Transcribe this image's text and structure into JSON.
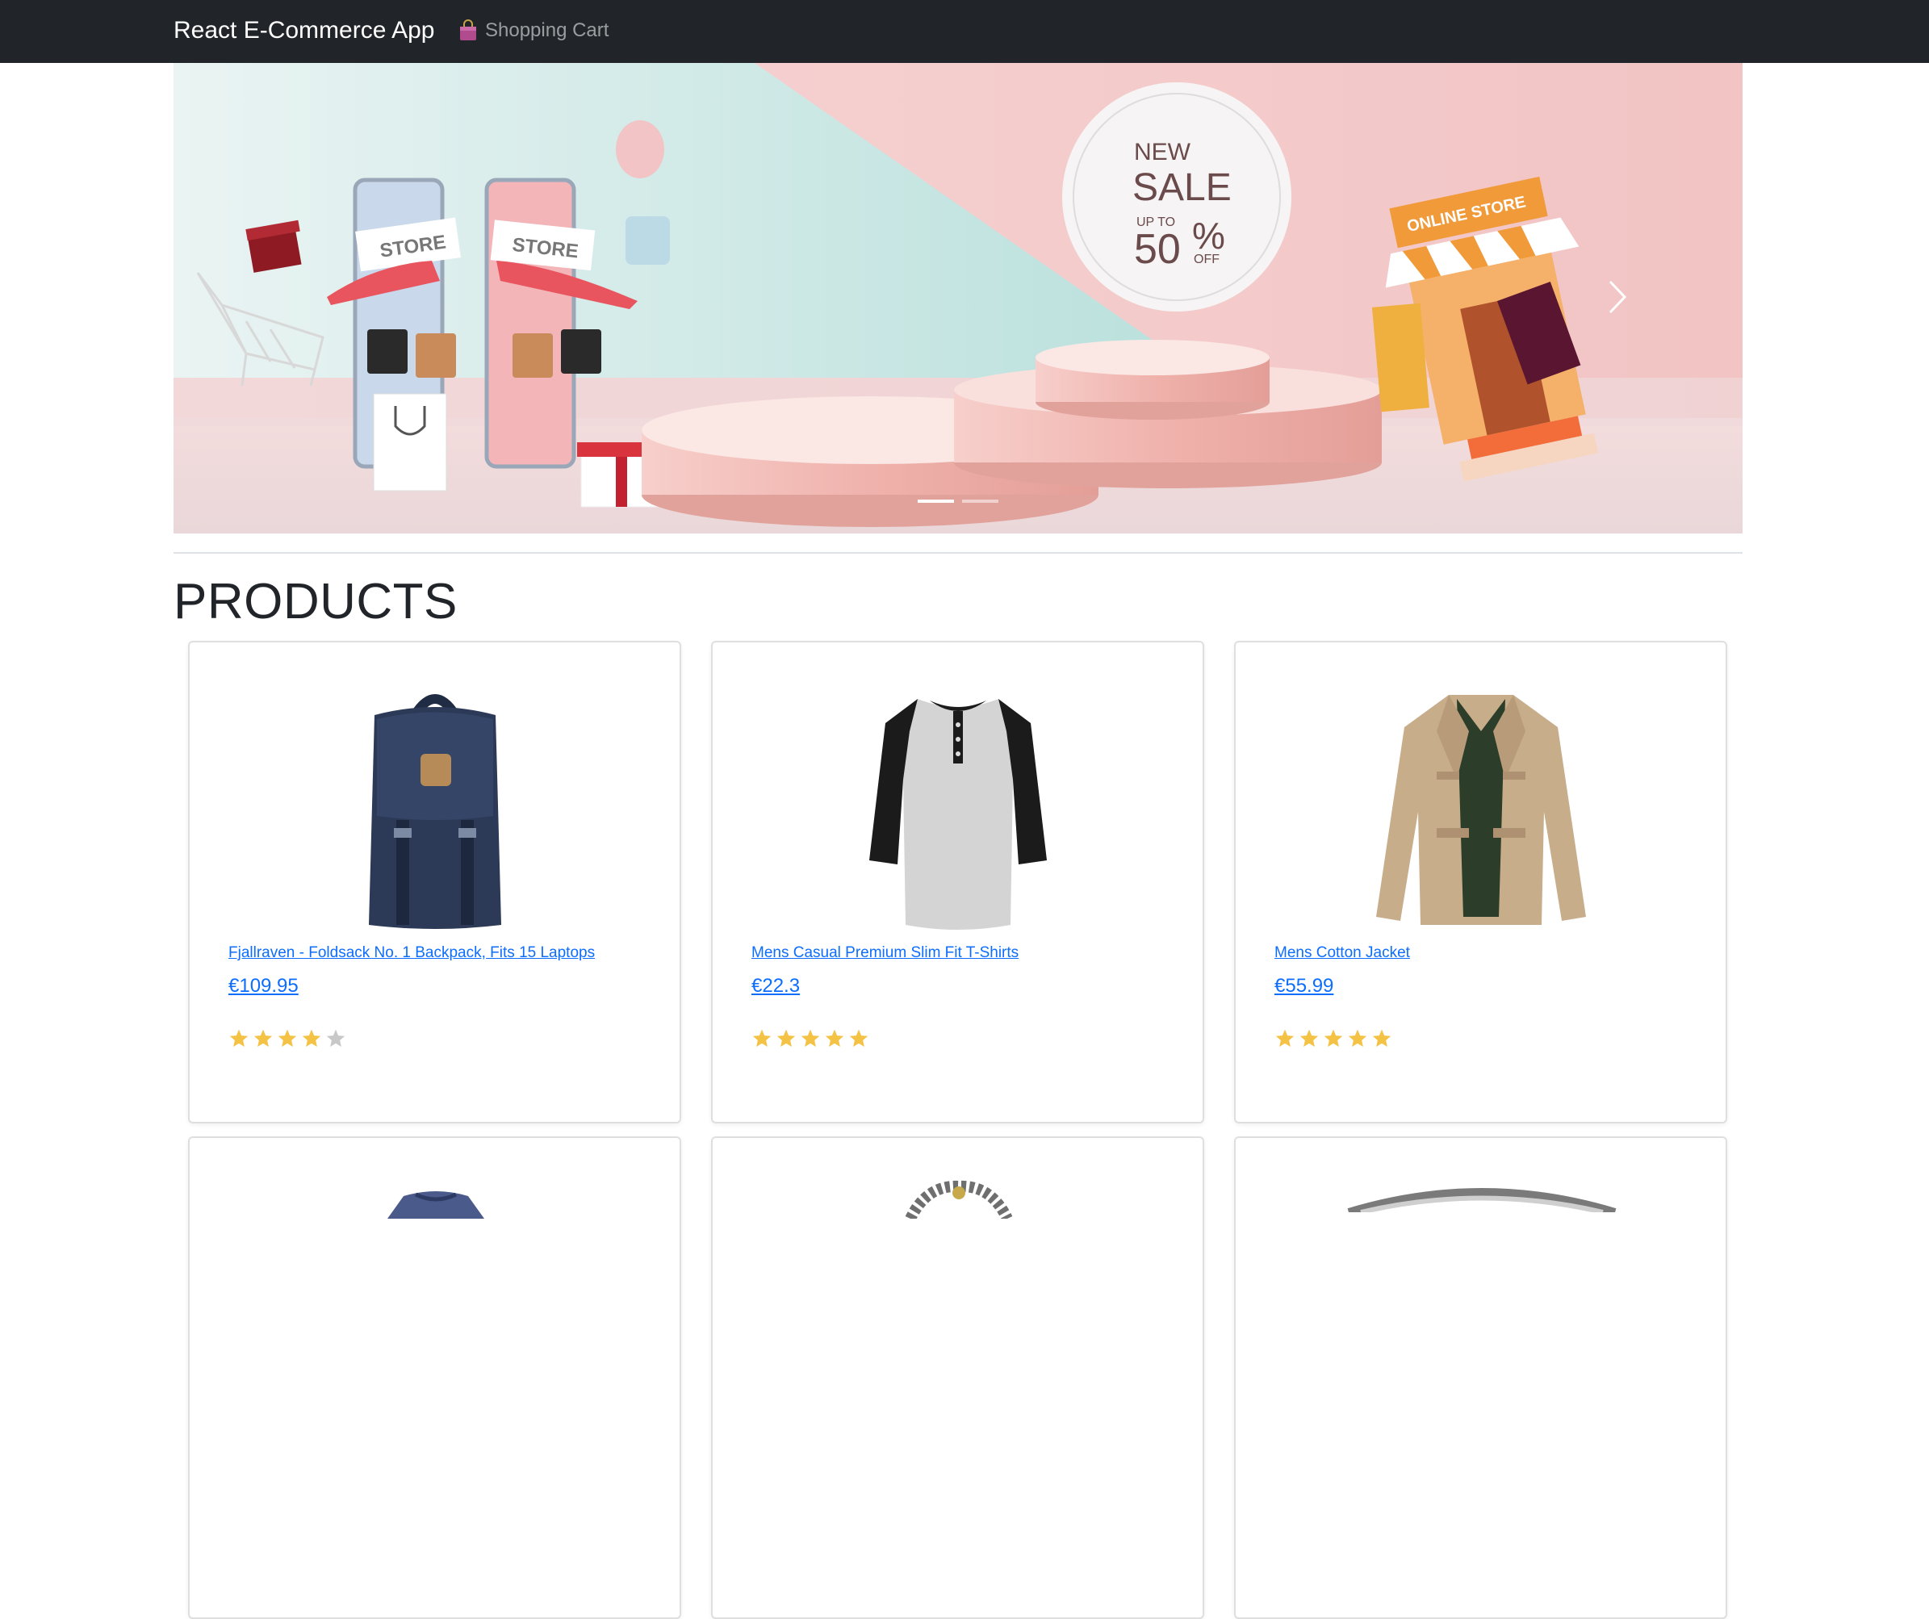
{
  "navbar": {
    "brand": "React E-Commerce App",
    "cart_link": "Shopping Cart"
  },
  "carousel": {
    "slide_count": 2,
    "active_slide": 1,
    "banner_text": {
      "store_left": "STORE",
      "store_right": "STORE",
      "badge_new": "NEW",
      "badge_sale": "SALE",
      "badge_upto": "UP TO",
      "badge_pct": "50",
      "badge_sym": "%",
      "badge_off": "OFF",
      "online_store": "ONLINE STORE"
    }
  },
  "products_section": {
    "title": "PRODUCTS",
    "items": [
      {
        "title": "Fjallraven - Foldsack No. 1 Backpack, Fits 15 Laptops",
        "price": "€109.95",
        "rating": 4,
        "max_rating": 5,
        "image": "backpack"
      },
      {
        "title": "Mens Casual Premium Slim Fit T-Shirts",
        "price": "€22.3",
        "rating": 5,
        "max_rating": 5,
        "image": "henley-shirt"
      },
      {
        "title": "Mens Cotton Jacket",
        "price": "€55.99",
        "rating": 5,
        "max_rating": 5,
        "image": "cotton-jacket"
      }
    ],
    "next_row_images": [
      "tshirt",
      "bracelet",
      "ring"
    ]
  },
  "colors": {
    "navbar_bg": "#212529",
    "link": "#0d6efd",
    "star_filled": "#f4c245",
    "star_empty": "#c8c8c8"
  }
}
